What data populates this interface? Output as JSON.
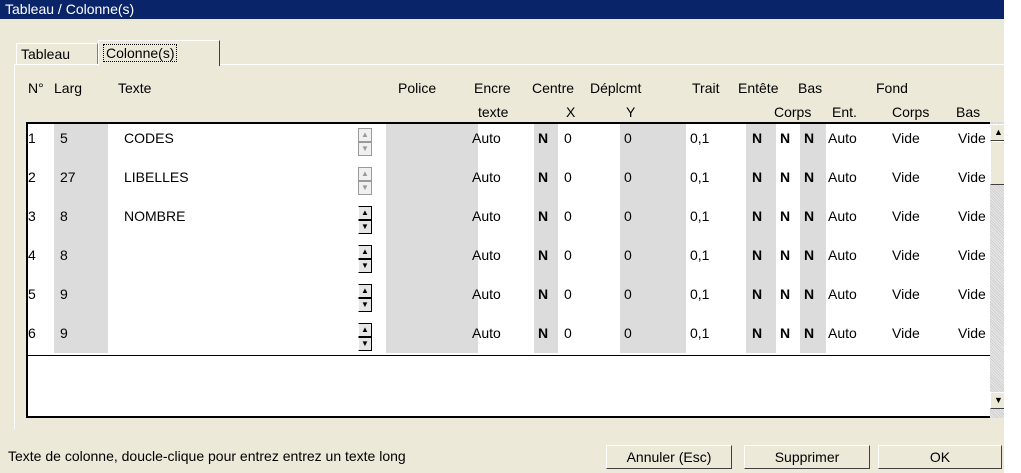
{
  "window": {
    "title": "Tableau / Colonne(s)"
  },
  "tabs": [
    {
      "label": "Tableau"
    },
    {
      "label": "Colonne(s)"
    }
  ],
  "headers": {
    "num": "N°",
    "larg": "Larg",
    "texte": "Texte",
    "police": "Police",
    "encre_1": "Encre",
    "encre_2": "texte",
    "centre": "Centre",
    "deplcmt": "Déplcmt",
    "x": "X",
    "y": "Y",
    "trait": "Trait",
    "entete": "Entête",
    "bas_1": "Bas",
    "corps": "Corps",
    "fond": "Fond",
    "ent": "Ent.",
    "fond_corps": "Corps",
    "fond_bas": "Bas"
  },
  "rows": [
    {
      "n": "1",
      "larg": "5",
      "texte": "CODES",
      "encre": "Auto",
      "centre": "N",
      "x": "0",
      "y": "0",
      "trait": "0,1",
      "entete": "N",
      "bas": "N",
      "corps": "N",
      "ent": "Auto",
      "fcorps": "Vide",
      "fbas": "Vide"
    },
    {
      "n": "2",
      "larg": "27",
      "texte": "LIBELLES",
      "encre": "Auto",
      "centre": "N",
      "x": "0",
      "y": "0",
      "trait": "0,1",
      "entete": "N",
      "bas": "N",
      "corps": "N",
      "ent": "Auto",
      "fcorps": "Vide",
      "fbas": "Vide"
    },
    {
      "n": "3",
      "larg": "8",
      "texte": "NOMBRE",
      "encre": "Auto",
      "centre": "N",
      "x": "0",
      "y": "0",
      "trait": "0,1",
      "entete": "N",
      "bas": "N",
      "corps": "N",
      "ent": "Auto",
      "fcorps": "Vide",
      "fbas": "Vide"
    },
    {
      "n": "4",
      "larg": "8",
      "texte": "",
      "encre": "Auto",
      "centre": "N",
      "x": "0",
      "y": "0",
      "trait": "0,1",
      "entete": "N",
      "bas": "N",
      "corps": "N",
      "ent": "Auto",
      "fcorps": "Vide",
      "fbas": "Vide"
    },
    {
      "n": "5",
      "larg": "9",
      "texte": "",
      "encre": "Auto",
      "centre": "N",
      "x": "0",
      "y": "0",
      "trait": "0,1",
      "entete": "N",
      "bas": "N",
      "corps": "N",
      "ent": "Auto",
      "fcorps": "Vide",
      "fbas": "Vide"
    },
    {
      "n": "6",
      "larg": "9",
      "texte": "",
      "encre": "Auto",
      "centre": "N",
      "x": "0",
      "y": "0",
      "trait": "0,1",
      "entete": "N",
      "bas": "N",
      "corps": "N",
      "ent": "Auto",
      "fcorps": "Vide",
      "fbas": "Vide"
    }
  ],
  "status_text": "Texte de colonne, doucle-clique pour entrez entrez un texte long",
  "buttons": {
    "cancel": "Annuler (Esc)",
    "delete": "Supprimer",
    "ok": "OK"
  },
  "icons": {
    "scroll_up": "▲",
    "scroll_down": "▼",
    "spin_up": "▲",
    "spin_down": "▼"
  },
  "colors": {
    "titlebar": "#0a246a",
    "face": "#ece9d8",
    "shaded_column": "#dcdcdc"
  }
}
